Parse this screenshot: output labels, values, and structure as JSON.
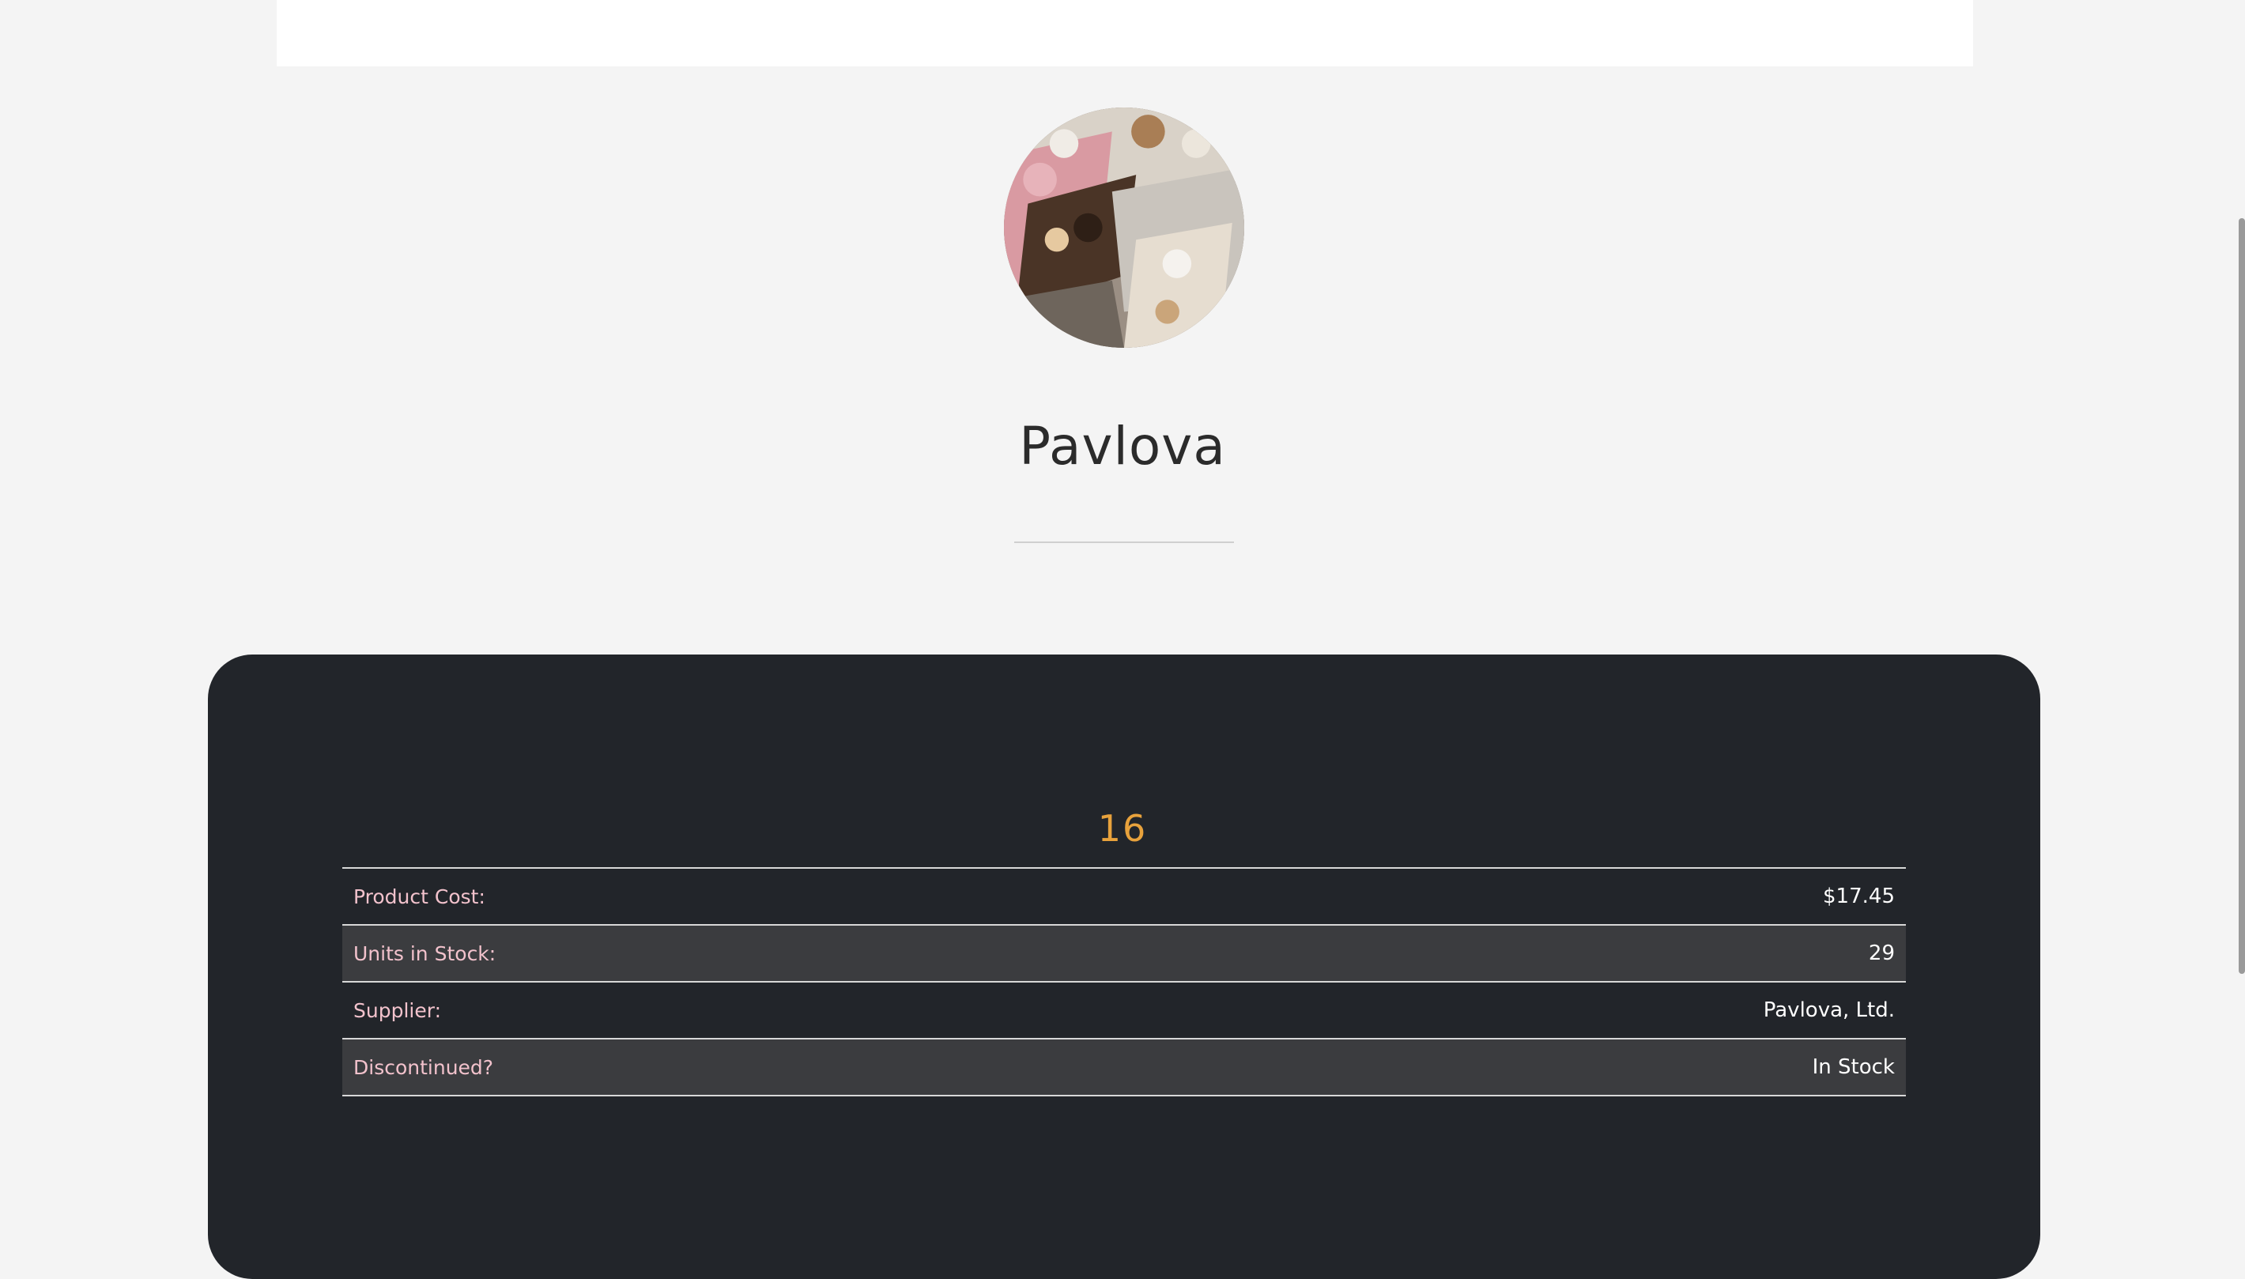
{
  "product": {
    "name": "Pavlova",
    "id": "16",
    "image_alt": "Assorted meringue desserts"
  },
  "details": [
    {
      "label": "Product Cost:",
      "value": "$17.45"
    },
    {
      "label": "Units in Stock:",
      "value": "29"
    },
    {
      "label": "Supplier:",
      "value": "Pavlova, Ltd."
    },
    {
      "label": "Discontinued?",
      "value": "In Stock"
    }
  ],
  "colors": {
    "page_background": "#f4f4f4",
    "card_background": "#22252a",
    "id_accent": "#e8a23c",
    "label_color": "#f2c2cc",
    "alt_row": "#3b3c3f"
  }
}
